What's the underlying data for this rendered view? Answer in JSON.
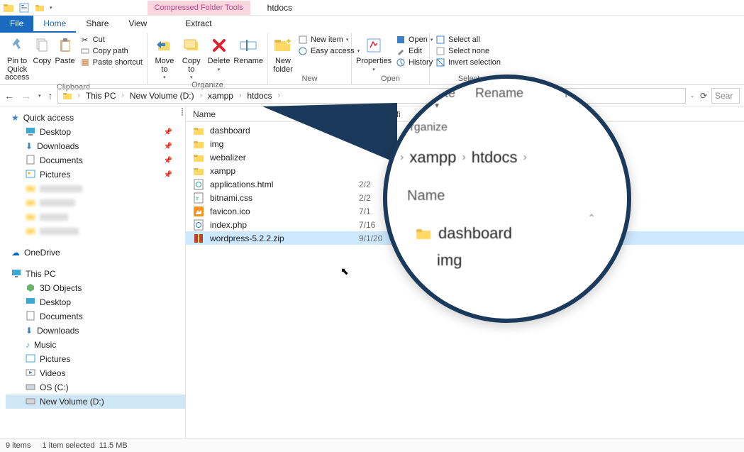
{
  "window": {
    "title": "htdocs",
    "context_tool_tab": "Compressed Folder Tools",
    "context_tab": "Extract"
  },
  "tabs": {
    "file": "File",
    "home": "Home",
    "share": "Share",
    "view": "View"
  },
  "ribbon": {
    "clipboard": {
      "label": "Clipboard",
      "pin": "Pin to Quick access",
      "copy": "Copy",
      "paste": "Paste",
      "cut": "Cut",
      "copy_path": "Copy path",
      "paste_shortcut": "Paste shortcut"
    },
    "organize": {
      "label": "Organize",
      "move_to": "Move to",
      "copy_to": "Copy to",
      "delete": "Delete",
      "rename": "Rename"
    },
    "new": {
      "label": "New",
      "new_folder": "New folder",
      "new_item": "New item",
      "easy_access": "Easy access"
    },
    "open": {
      "label": "Open",
      "properties": "Properties",
      "open": "Open",
      "edit": "Edit",
      "history": "History"
    },
    "select": {
      "label": "Select",
      "select_all": "Select all",
      "select_none": "Select none",
      "invert": "Invert selection"
    }
  },
  "address": {
    "segments": [
      "This PC",
      "New Volume (D:)",
      "xampp",
      "htdocs"
    ],
    "search_placeholder": "Sear"
  },
  "nav": {
    "quick_access": "Quick access",
    "pinned": [
      "Desktop",
      "Downloads",
      "Documents",
      "Pictures"
    ],
    "onedrive": "OneDrive",
    "this_pc": "This PC",
    "this_pc_items": [
      "3D Objects",
      "Desktop",
      "Documents",
      "Downloads",
      "Music",
      "Pictures",
      "Videos",
      "OS (C:)",
      "New Volume (D:)"
    ]
  },
  "columns": {
    "name": "Name",
    "date": "Date modifi"
  },
  "files": [
    {
      "name": "dashboard",
      "type": "folder",
      "date": ""
    },
    {
      "name": "img",
      "type": "folder",
      "date": ""
    },
    {
      "name": "webalizer",
      "type": "folder",
      "date": ""
    },
    {
      "name": "xampp",
      "type": "folder",
      "date": ""
    },
    {
      "name": "applications.html",
      "type": "html",
      "date": "2/2"
    },
    {
      "name": "bitnami.css",
      "type": "css",
      "date": "2/2"
    },
    {
      "name": "favicon.ico",
      "type": "ico",
      "date": "7/1"
    },
    {
      "name": "index.php",
      "type": "php",
      "date": "7/16"
    },
    {
      "name": "wordpress-5.2.2.zip",
      "type": "zip",
      "date": "9/1/20",
      "selected": true
    }
  ],
  "status": {
    "items": "9 items",
    "selection": "1 item selected",
    "size": "11.5 MB"
  },
  "callout": {
    "delete": "Delete",
    "rename": "Rename",
    "new_folder": "New folder",
    "organize": "Organize",
    "path_seg1": "xampp",
    "path_seg2": "htdocs",
    "name_header": "Name",
    "row1": "dashboard",
    "row2": "img"
  }
}
